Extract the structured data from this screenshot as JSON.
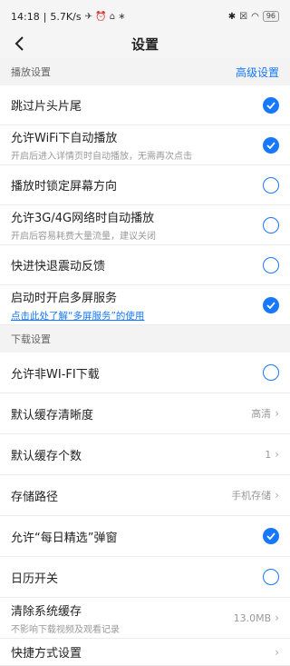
{
  "status_bar": {
    "time": "14:18",
    "network_speed": "5.7K/s",
    "battery": "96"
  },
  "header": {
    "title": "设置"
  },
  "playback_section": {
    "title": "播放设置",
    "advanced_link": "高级设置"
  },
  "playback_items": [
    {
      "label": "跳过片头片尾",
      "checked": true
    },
    {
      "label": "允许WiFi下自动播放",
      "desc": "开启后进入详情页时自动播放，无需再次点击",
      "checked": true
    },
    {
      "label": "播放时锁定屏幕方向",
      "checked": false
    },
    {
      "label": "允许3G/4G网络时自动播放",
      "desc": "开启后容易耗费大量流量，建议关闭",
      "checked": false
    },
    {
      "label": "快进快退震动反馈",
      "checked": false
    },
    {
      "label": "启动时开启多屏服务",
      "link": "点击此处了解“多屏服务”的使用",
      "checked": true
    }
  ],
  "download_section": {
    "title": "下载设置"
  },
  "download_items": {
    "allow_non_wifi": {
      "label": "允许非WI-FI下载",
      "checked": false
    },
    "default_quality": {
      "label": "默认缓存清晰度",
      "value": "高清"
    },
    "default_count": {
      "label": "默认缓存个数",
      "value": "1"
    },
    "storage_path": {
      "label": "存储路径",
      "value": "手机存储"
    },
    "daily_popup": {
      "label": "允许“每日精选”弹窗",
      "checked": true
    },
    "calendar": {
      "label": "日历开关",
      "checked": false
    },
    "clear_cache": {
      "label": "清除系统缓存",
      "desc": "不影响下载视频及观看记录",
      "value": "13.0MB"
    },
    "shortcut": {
      "label": "快捷方式设置"
    }
  },
  "colors": {
    "accent": "#1677ff",
    "background": "#f5f5f5"
  }
}
